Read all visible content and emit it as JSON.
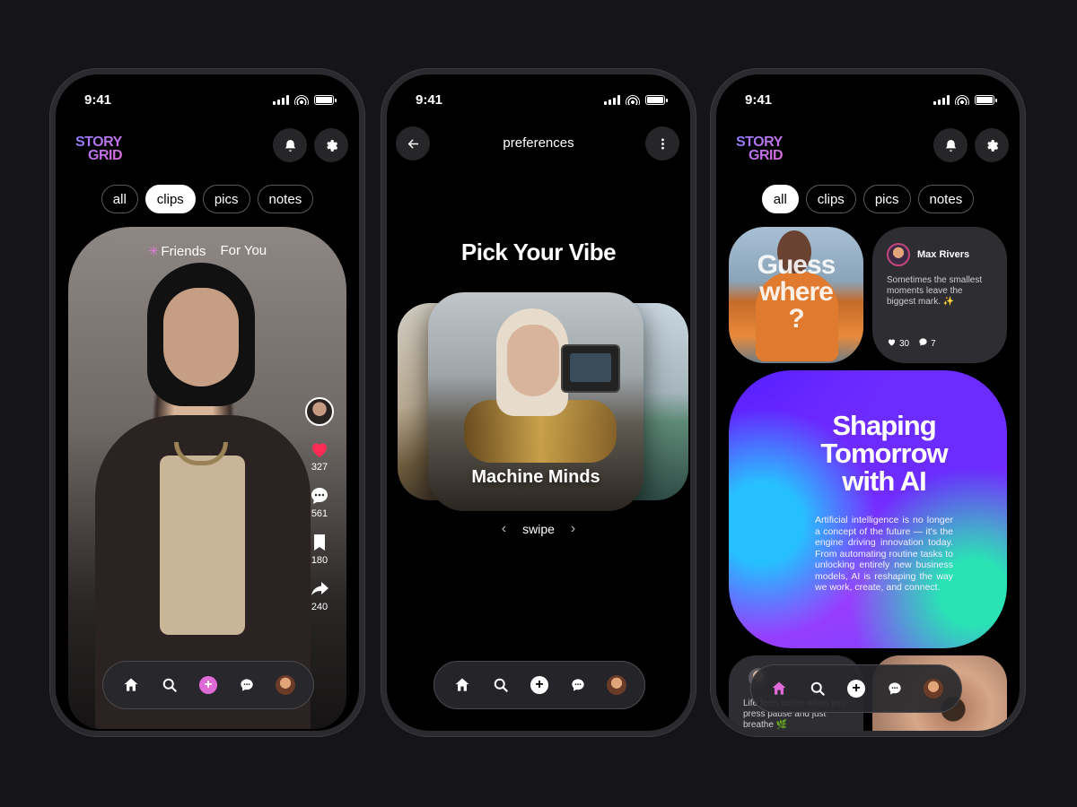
{
  "status": {
    "time": "9:41"
  },
  "phone1": {
    "logo": {
      "line1": "STORY",
      "line2": "GRID"
    },
    "filters": [
      {
        "label": "all",
        "active": false
      },
      {
        "label": "clips",
        "active": true
      },
      {
        "label": "pics",
        "active": false
      },
      {
        "label": "notes",
        "active": false
      }
    ],
    "feed_tabs": {
      "star": "✳",
      "friends": "Friends",
      "for_you": "For You"
    },
    "actions": {
      "likes": "327",
      "comments": "561",
      "saves": "180",
      "shares": "240"
    },
    "nav": {
      "add_symbol": "+"
    }
  },
  "phone2": {
    "title": "preferences",
    "heading": "Pick Your Vibe",
    "card_label": "Machine Minds",
    "swipe": {
      "label": "swipe",
      "prev": "‹",
      "next": "›"
    },
    "nav": {
      "add_symbol": "+"
    }
  },
  "phone3": {
    "logo": {
      "line1": "STORY",
      "line2": "GRID"
    },
    "filters": [
      {
        "label": "all",
        "active": true
      },
      {
        "label": "clips",
        "active": false
      },
      {
        "label": "pics",
        "active": false
      },
      {
        "label": "notes",
        "active": false
      }
    ],
    "photo_tile_text": {
      "line1": "Guess",
      "line2": "where",
      "line3": "?"
    },
    "post": {
      "author": "Max Rivers",
      "body": "Sometimes the smallest moments leave the biggest mark. ✨",
      "likes": "30",
      "comments": "7"
    },
    "ai_card": {
      "title_line1": "Shaping",
      "title_line2": "Tomorrow",
      "title_line3": "with AI",
      "body": "Artificial intelligence is no longer a concept of the future — it's the engine driving innovation today. From automating routine tasks to unlocking entirely new business models, AI is reshaping the way we work, create, and connect."
    },
    "bottom_post": {
      "body": "Life feels better when you press pause and just breathe 🌿"
    },
    "nav": {
      "add_symbol": "+"
    }
  },
  "colors": {
    "accent_pink": "#e06bd8",
    "accent_purple": "#8e7cff",
    "like_red": "#ff2d55"
  }
}
